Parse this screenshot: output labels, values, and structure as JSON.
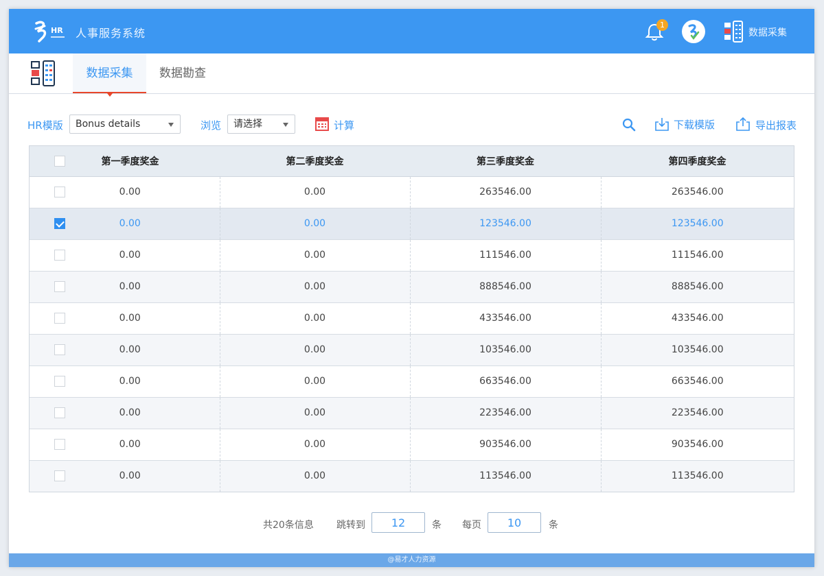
{
  "header": {
    "title": "人事服务系统",
    "logo_text": "HR",
    "notification_count": "1",
    "module_label": "数据采集"
  },
  "tabs": [
    {
      "label": "数据采集",
      "active": true
    },
    {
      "label": "数据勘查",
      "active": false
    }
  ],
  "toolbar": {
    "template_label": "HR模版",
    "template_value": "Bonus details",
    "browse_label": "浏览",
    "browse_placeholder": "请选择",
    "calc_label": "计算",
    "download_label": "下载模版",
    "export_label": "导出报表"
  },
  "table": {
    "headers": [
      "第一季度奖金",
      "第二季度奖金",
      "第三季度奖金",
      "第四季度奖金"
    ],
    "rows": [
      {
        "checked": false,
        "cells": [
          "0.00",
          "0.00",
          "263546.00",
          "263546.00"
        ]
      },
      {
        "checked": true,
        "cells": [
          "0.00",
          "0.00",
          "123546.00",
          "123546.00"
        ]
      },
      {
        "checked": false,
        "cells": [
          "0.00",
          "0.00",
          "111546.00",
          "111546.00"
        ]
      },
      {
        "checked": false,
        "cells": [
          "0.00",
          "0.00",
          "888546.00",
          "888546.00"
        ]
      },
      {
        "checked": false,
        "cells": [
          "0.00",
          "0.00",
          "433546.00",
          "433546.00"
        ]
      },
      {
        "checked": false,
        "cells": [
          "0.00",
          "0.00",
          "103546.00",
          "103546.00"
        ]
      },
      {
        "checked": false,
        "cells": [
          "0.00",
          "0.00",
          "663546.00",
          "663546.00"
        ]
      },
      {
        "checked": false,
        "cells": [
          "0.00",
          "0.00",
          "223546.00",
          "223546.00"
        ]
      },
      {
        "checked": false,
        "cells": [
          "0.00",
          "0.00",
          "903546.00",
          "903546.00"
        ]
      },
      {
        "checked": false,
        "cells": [
          "0.00",
          "0.00",
          "113546.00",
          "113546.00"
        ]
      }
    ]
  },
  "pagination": {
    "total_text": "共20条信息",
    "jump_label": "跳转到",
    "jump_value": "12",
    "unit1": "条",
    "per_page_label": "每页",
    "per_page_value": "10",
    "unit2": "条"
  },
  "footer": {
    "text": "@易才人力资源"
  },
  "colors": {
    "brand": "#3c97f2",
    "accent": "#e8462a",
    "badge": "#f5a623"
  }
}
